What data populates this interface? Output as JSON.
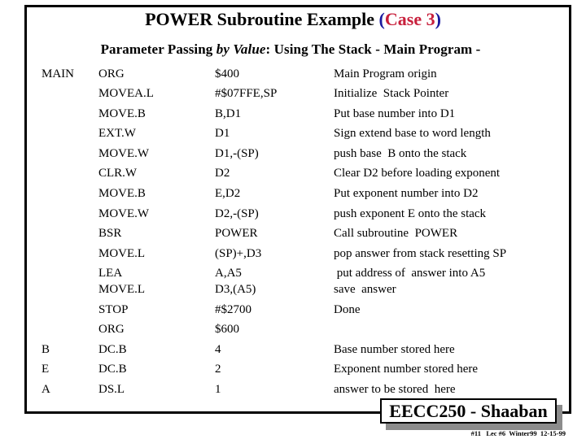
{
  "slide": {
    "title_main": "POWER Subroutine Example ",
    "title_paren_open": "(",
    "title_case": "Case 3",
    "title_paren_close": ")",
    "subtitle_pre": "Parameter Passing ",
    "subtitle_italic": "by Value",
    "subtitle_post": ": Using The Stack  -  Main Program  -",
    "colors": {
      "paren": "#1a1a9e",
      "case": "#c8203c"
    }
  },
  "program": {
    "rows": [
      {
        "label": "MAIN",
        "op": "ORG",
        "arg": "$400",
        "comment": "Main Program origin"
      },
      {
        "label": "",
        "op": "MOVEA.L",
        "arg": "#$07FFE,SP",
        "comment": "Initialize  Stack Pointer"
      },
      {
        "label": "",
        "op": "MOVE.B",
        "arg": "B,D1",
        "comment": "Put base number into D1"
      },
      {
        "label": "",
        "op": "EXT.W",
        "arg": "D1",
        "comment": "Sign extend base to word length"
      },
      {
        "label": "",
        "op": "MOVE.W",
        "arg": "D1,-(SP)",
        "comment": "push base  B onto the stack"
      },
      {
        "label": "",
        "op": "CLR.W",
        "arg": "D2",
        "comment": "Clear D2 before loading exponent"
      },
      {
        "label": "",
        "op": "MOVE.B",
        "arg": "E,D2",
        "comment": "Put exponent number into D2"
      },
      {
        "label": "",
        "op": "MOVE.W",
        "arg": "D2,-(SP)",
        "comment": "push exponent E onto the stack"
      },
      {
        "label": "",
        "op": "BSR",
        "arg": "POWER",
        "comment": "Call subroutine  POWER"
      },
      {
        "label": "",
        "op": "MOVE.L",
        "arg": "(SP)+,D3",
        "comment": "pop answer from stack resetting SP"
      },
      {
        "label": "",
        "op": "LEA",
        "arg": "A,A5",
        "comment": " put address of  answer into A5"
      },
      {
        "label": "",
        "op": "MOVE.L",
        "arg": "D3,(A5)",
        "comment": "save  answer"
      },
      {
        "label": "",
        "op": "STOP",
        "arg": "#$2700",
        "comment": "Done"
      },
      {
        "label": "",
        "op": "ORG",
        "arg": "$600",
        "comment": ""
      },
      {
        "label": "B",
        "op": "DC.B",
        "arg": "4",
        "comment": "Base number stored here"
      },
      {
        "label": "E",
        "op": "DC.B",
        "arg": "2",
        "comment": "Exponent number stored here"
      },
      {
        "label": "A",
        "op": "DS.L",
        "arg": "1",
        "comment": "answer to be stored  here"
      }
    ]
  },
  "footer": {
    "course": "EECC250 - Shaaban",
    "meta": "#11   Lec #6  Winter99  12-15-99"
  }
}
